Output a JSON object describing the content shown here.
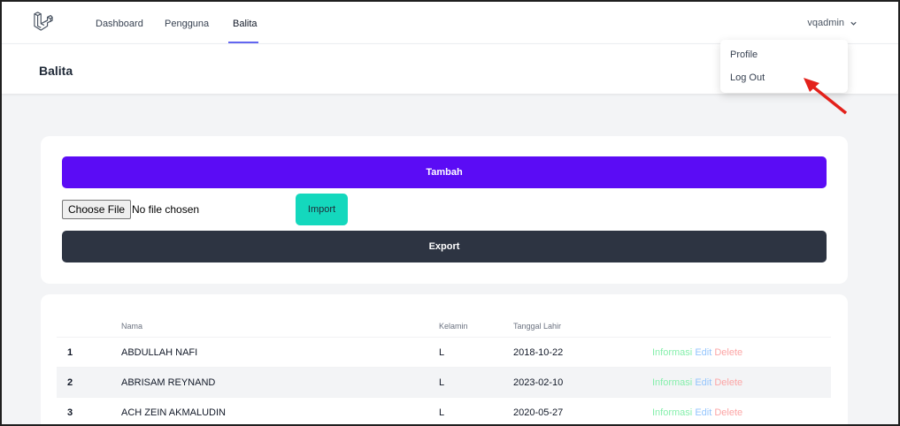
{
  "nav": {
    "links": [
      "Dashboard",
      "Pengguna",
      "Balita"
    ],
    "user": "vqadmin"
  },
  "dropdown": {
    "items": [
      "Profile",
      "Log Out"
    ]
  },
  "page": {
    "title": "Balita"
  },
  "actions": {
    "tambah": "Tambah",
    "file_choose": "Choose File",
    "file_status": "No file chosen",
    "import": "Import",
    "export": "Export"
  },
  "table": {
    "headers": [
      "Nama",
      "Kelamin",
      "Tanggal Lahir"
    ],
    "rows": [
      {
        "no": "1",
        "nama": "ABDULLAH NAFI",
        "kelamin": "L",
        "tanggal": "2018-10-22"
      },
      {
        "no": "2",
        "nama": "ABRISAM REYNAND",
        "kelamin": "L",
        "tanggal": "2023-02-10"
      },
      {
        "no": "3",
        "nama": "ACH ZEIN AKMALUDIN",
        "kelamin": "L",
        "tanggal": "2020-05-27"
      }
    ],
    "row_actions": {
      "info": "Informasi",
      "edit": "Edit",
      "delete": "Delete"
    }
  },
  "colors": {
    "primary": "#5b0cf5",
    "import": "#14d8bd",
    "export": "#2d3442",
    "annotation": "#e3211b"
  }
}
